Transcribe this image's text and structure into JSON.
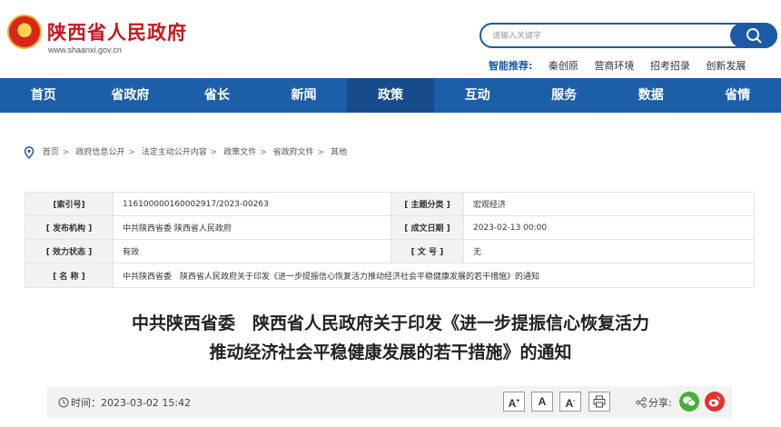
{
  "header": {
    "site_title": "陕西省人民政府",
    "site_url": "www.shaanxi.gov.cn",
    "search_placeholder": "请输入关键字",
    "recommend_label": "智能推荐:",
    "recommend_links": [
      "秦创原",
      "营商环境",
      "招考招录",
      "创新发展"
    ]
  },
  "nav": {
    "items": [
      "首页",
      "省政府",
      "省长",
      "新闻",
      "政策",
      "互动",
      "服务",
      "数据",
      "省情"
    ],
    "active": "政策"
  },
  "breadcrumb": [
    "首页",
    "政府信息公开",
    "法定主动公开内容",
    "政策文件",
    "省政府文件",
    "其他"
  ],
  "info": {
    "index_label": "[索引号]",
    "index_value": "116100000160002917/2023-00263",
    "topic_label": "[ 主题分类 ]",
    "topic_value": "宏观经济",
    "issuer_label": "[ 发布机构 ]",
    "issuer_value": "中共陕西省委 陕西省人民政府",
    "date_label": "[ 成文日期 ]",
    "date_value": "2023-02-13 00:00",
    "status_label": "[ 效力状态 ]",
    "status_value": "有效",
    "docno_label": "[ 文 号 ]",
    "docno_value": "无",
    "name_label": "[ 名 称 ]",
    "name_value": "中共陕西省委　陕西省人民政府关于印发《进一步提振信心恢复活力推动经济社会平稳健康发展的若干措施》的通知"
  },
  "article": {
    "title_line1": "中共陕西省委　陕西省人民政府关于印发《进一步提振信心恢复活力",
    "title_line2": "推动经济社会平稳健康发展的若干措施》的通知"
  },
  "toolbar": {
    "time": "时间：2023-03-02 15:42",
    "font_large": "A",
    "font_large_mark": "+",
    "font_medium": "A",
    "font_small": "A",
    "font_small_mark": "-",
    "share_label": "分享:"
  }
}
